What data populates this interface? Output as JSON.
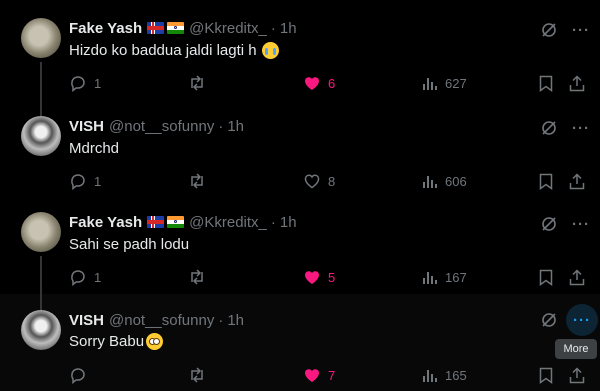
{
  "tweets": [
    {
      "name": "Fake Yash",
      "flags": [
        "iceland-flag",
        "india-flag"
      ],
      "handle": "@Kkreditx_",
      "dot": "·",
      "time": "1h",
      "text": "Hizdo ko baddua jaldi lagti h",
      "emoji": "loudly-crying-emoji",
      "replies": "1",
      "retweets": "",
      "likes": "6",
      "liked": true,
      "views": "627"
    },
    {
      "name": "VISH",
      "flags": [],
      "handle": "@not__sofunny",
      "dot": "·",
      "time": "1h",
      "text": "Mdrchd",
      "emoji": "",
      "replies": "1",
      "retweets": "",
      "likes": "8",
      "liked": false,
      "views": "606"
    },
    {
      "name": "Fake Yash",
      "flags": [
        "iceland-flag",
        "india-flag"
      ],
      "handle": "@Kkreditx_",
      "dot": "·",
      "time": "1h",
      "text": "Sahi se padh lodu",
      "emoji": "",
      "replies": "1",
      "retweets": "",
      "likes": "5",
      "liked": true,
      "views": "167"
    },
    {
      "name": "VISH",
      "flags": [],
      "handle": "@not__sofunny",
      "dot": "·",
      "time": "1h",
      "text": "Sorry Babu",
      "emoji": "pleading-face-emoji",
      "replies": "",
      "retweets": "",
      "likes": "7",
      "liked": true,
      "views": "165"
    }
  ],
  "tooltip": "More",
  "colors": {
    "background": "#000000",
    "text": "#e7e9ea",
    "muted": "#71767b",
    "like": "#f91880",
    "accent": "#1d9bf0"
  }
}
